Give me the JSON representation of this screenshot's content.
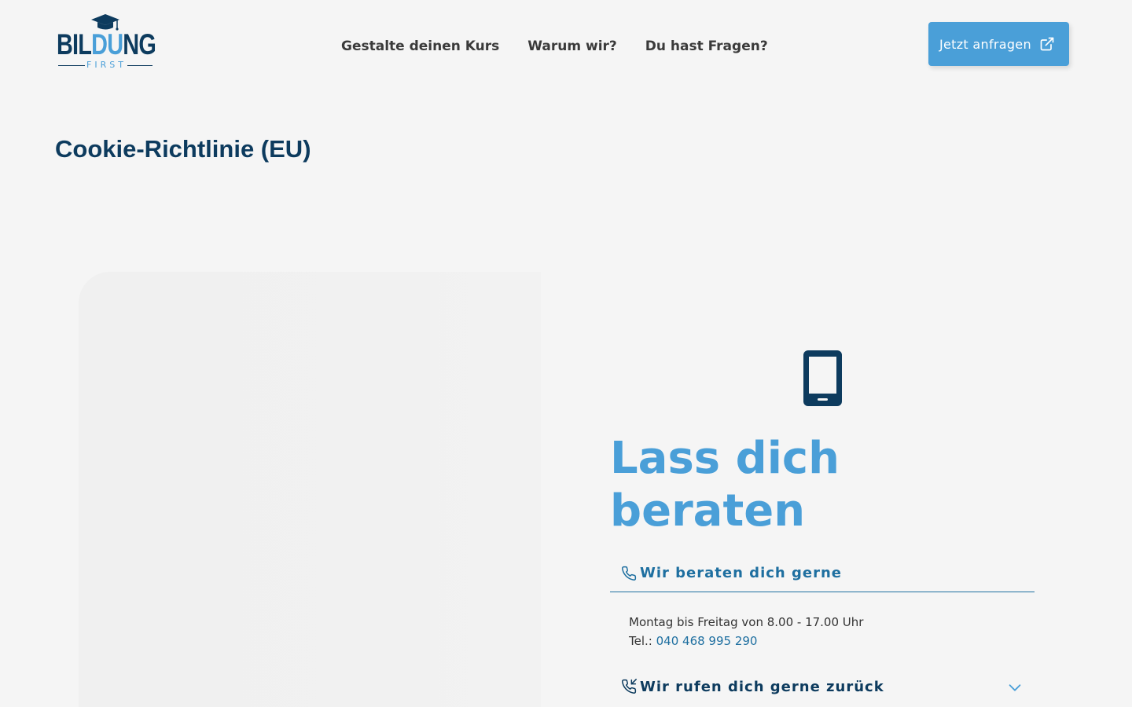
{
  "header": {
    "logo": {
      "word_dark_1": "BIL",
      "word_light": "DU",
      "word_dark_2": "NG",
      "sub": "FIRST"
    },
    "nav": [
      "Gestalte deinen Kurs",
      "Warum wir?",
      "Du hast Fragen?"
    ],
    "cta_label": "Jetzt anfragen",
    "cta_icon": "external-link-icon"
  },
  "page": {
    "title": "Cookie-Richtlinie (EU)"
  },
  "contact": {
    "icon": "smartphone-icon",
    "heading_line1": "Lass dich",
    "heading_line2": "beraten",
    "accordion": [
      {
        "icon": "phone-icon",
        "title": "Wir beraten dich gerne",
        "hours": "Montag bis Freitag von 8.00 - 17.00 Uhr",
        "tel_label": "Tel.:",
        "tel_number": "040 468 995 290"
      },
      {
        "icon": "phone-callback-icon",
        "title": "Wir rufen dich gerne zurück",
        "toggle_icon": "chevron-down-icon"
      }
    ]
  },
  "colors": {
    "navy": "#0d3b5e",
    "accent_blue": "#4a9fd8",
    "link_blue": "#1e6fa0",
    "background": "#f5f5f5"
  }
}
